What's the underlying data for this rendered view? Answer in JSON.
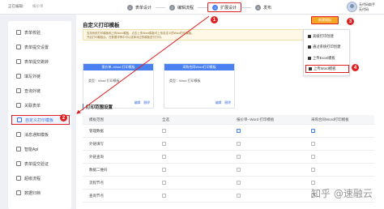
{
  "header": {
    "edit_state": "正在编辑:",
    "doc_name": "报价单",
    "steps": [
      {
        "num": "1",
        "label": "表单设计"
      },
      {
        "num": "2",
        "label": "编辑流程"
      },
      {
        "num": "3",
        "label": "扩展设计"
      },
      {
        "num": "4",
        "label": "发布"
      }
    ],
    "user_line1": "无代码助手",
    "user_line2": "无代码"
  },
  "sidebar": {
    "items": [
      "表单校验",
      "表单提交设置",
      "表单提交跳转",
      "填写外链",
      "查询外链",
      "关联表单",
      "自定义打印模板",
      "消息通知模板",
      "智能Api",
      "表单提交验证",
      "超级流程",
      "数据归档"
    ]
  },
  "main": {
    "title": "自定义打印模板",
    "info_line1": "支持系统打印模板和上传Word模板，点击上传Word模板可上传自定义的Word打印模板。",
    "info_line2": "开启打印模板后，在数据详情中可以选择对应的模板进行打印。",
    "cards": [
      {
        "header": "报价单--Word 打印模板",
        "type": "类型：Word 打印模板",
        "actions": [
          "编辑",
          "删除"
        ]
      },
      {
        "header": "采购合同Word打印模板",
        "type": "类型：Word 打印模板",
        "actions": [
          "编辑",
          "删除"
        ]
      }
    ],
    "section_title": "打印范围设置",
    "table": {
      "headers": [
        "模板范围",
        "全选",
        "报价单--Word 打印模板",
        "采购合同Word打印模板"
      ],
      "rows": [
        {
          "label": "管理数据",
          "checks": [
            false,
            true,
            true
          ]
        },
        {
          "label": "外链填写",
          "checks": [
            false,
            false,
            false
          ]
        },
        {
          "label": "外链查询",
          "checks": [
            false,
            false,
            false
          ]
        },
        {
          "label": "数据二维码",
          "checks": [
            false,
            false,
            false
          ]
        },
        {
          "label": "流程节点",
          "checks": [
            false,
            false,
            false
          ]
        },
        {
          "label": "查询节点",
          "checks": [
            false,
            false,
            false
          ]
        }
      ]
    }
  },
  "dropdown": {
    "button_label": "新建模板",
    "items": [
      "高级打印创建",
      "通过系统打印创建",
      "上传Excel模板",
      "上传Word模板"
    ]
  },
  "callouts": [
    "1",
    "2",
    "3",
    "4"
  ],
  "watermark": "知乎 @速融云",
  "colors": {
    "accent": "#4a80f0",
    "highlight": "#e02020",
    "button": "#f5a623"
  }
}
